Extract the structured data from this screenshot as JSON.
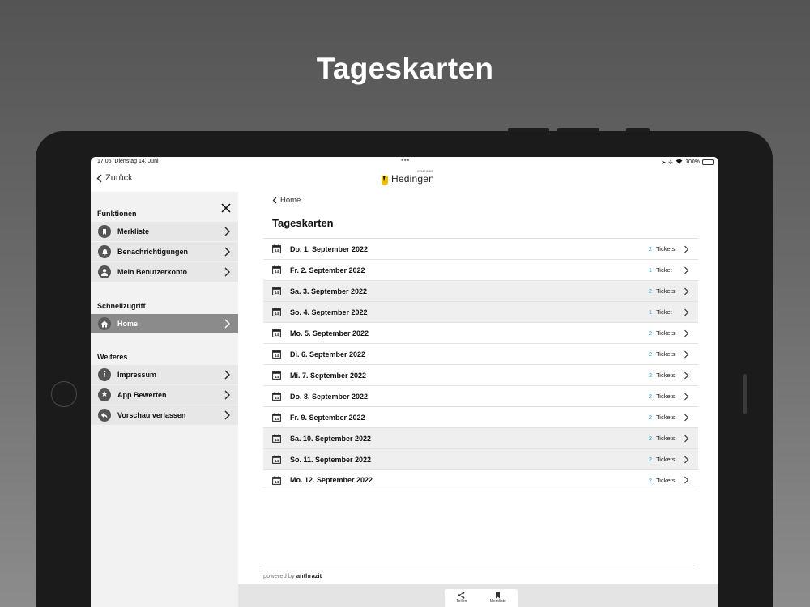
{
  "promo": {
    "title": "Tageskarten"
  },
  "status_bar": {
    "time": "17:05",
    "date": "Dienstag 14. Juni",
    "battery": "100%"
  },
  "nav": {
    "back_label": "Zurück",
    "logo_text": "Hedingen",
    "logo_small": "GEMEINDE"
  },
  "sidebar": {
    "sections": [
      {
        "title": "Funktionen",
        "items": [
          {
            "label": "Merkliste",
            "icon": "bookmark-icon"
          },
          {
            "label": "Benachrichtigungen",
            "icon": "bell-icon"
          },
          {
            "label": "Mein Benutzerkonto",
            "icon": "user-icon"
          }
        ]
      },
      {
        "title": "Schnellzugriff",
        "items": [
          {
            "label": "Home",
            "icon": "home-icon",
            "active": true
          }
        ]
      },
      {
        "title": "Weiteres",
        "items": [
          {
            "label": "Impressum",
            "icon": "info-icon"
          },
          {
            "label": "App Bewerten",
            "icon": "star-icon"
          },
          {
            "label": "Vorschau verlassen",
            "icon": "undo-icon"
          }
        ]
      }
    ]
  },
  "main": {
    "breadcrumb": "Home",
    "title": "Tageskarten",
    "rows": [
      {
        "date": "Do. 1. September 2022",
        "count": "2",
        "unit": "Tickets",
        "highlight": false
      },
      {
        "date": "Fr. 2. September 2022",
        "count": "1",
        "unit": "Ticket",
        "highlight": false
      },
      {
        "date": "Sa. 3. September 2022",
        "count": "2",
        "unit": "Tickets",
        "highlight": true
      },
      {
        "date": "So. 4. September 2022",
        "count": "1",
        "unit": "Ticket",
        "highlight": true
      },
      {
        "date": "Mo. 5. September 2022",
        "count": "2",
        "unit": "Tickets",
        "highlight": false
      },
      {
        "date": "Di. 6. September 2022",
        "count": "2",
        "unit": "Tickets",
        "highlight": false
      },
      {
        "date": "Mi. 7. September 2022",
        "count": "2",
        "unit": "Tickets",
        "highlight": false
      },
      {
        "date": "Do. 8. September 2022",
        "count": "2",
        "unit": "Tickets",
        "highlight": false
      },
      {
        "date": "Fr. 9. September 2022",
        "count": "2",
        "unit": "Tickets",
        "highlight": false
      },
      {
        "date": "Sa. 10. September 2022",
        "count": "2",
        "unit": "Tickets",
        "highlight": true
      },
      {
        "date": "So. 11. September 2022",
        "count": "2",
        "unit": "Tickets",
        "highlight": true
      },
      {
        "date": "Mo. 12. September 2022",
        "count": "2",
        "unit": "Tickets",
        "highlight": false
      }
    ],
    "calendar_day": "14",
    "powered_prefix": "powered by",
    "powered_brand": "anthrazit"
  },
  "bottom_bar": {
    "share_label": "Teilen",
    "bookmark_label": "Merkliste"
  },
  "colors": {
    "accent": "#2a9fd6",
    "logo_yellow": "#f2c200",
    "active_item": "#8b8b8b"
  }
}
